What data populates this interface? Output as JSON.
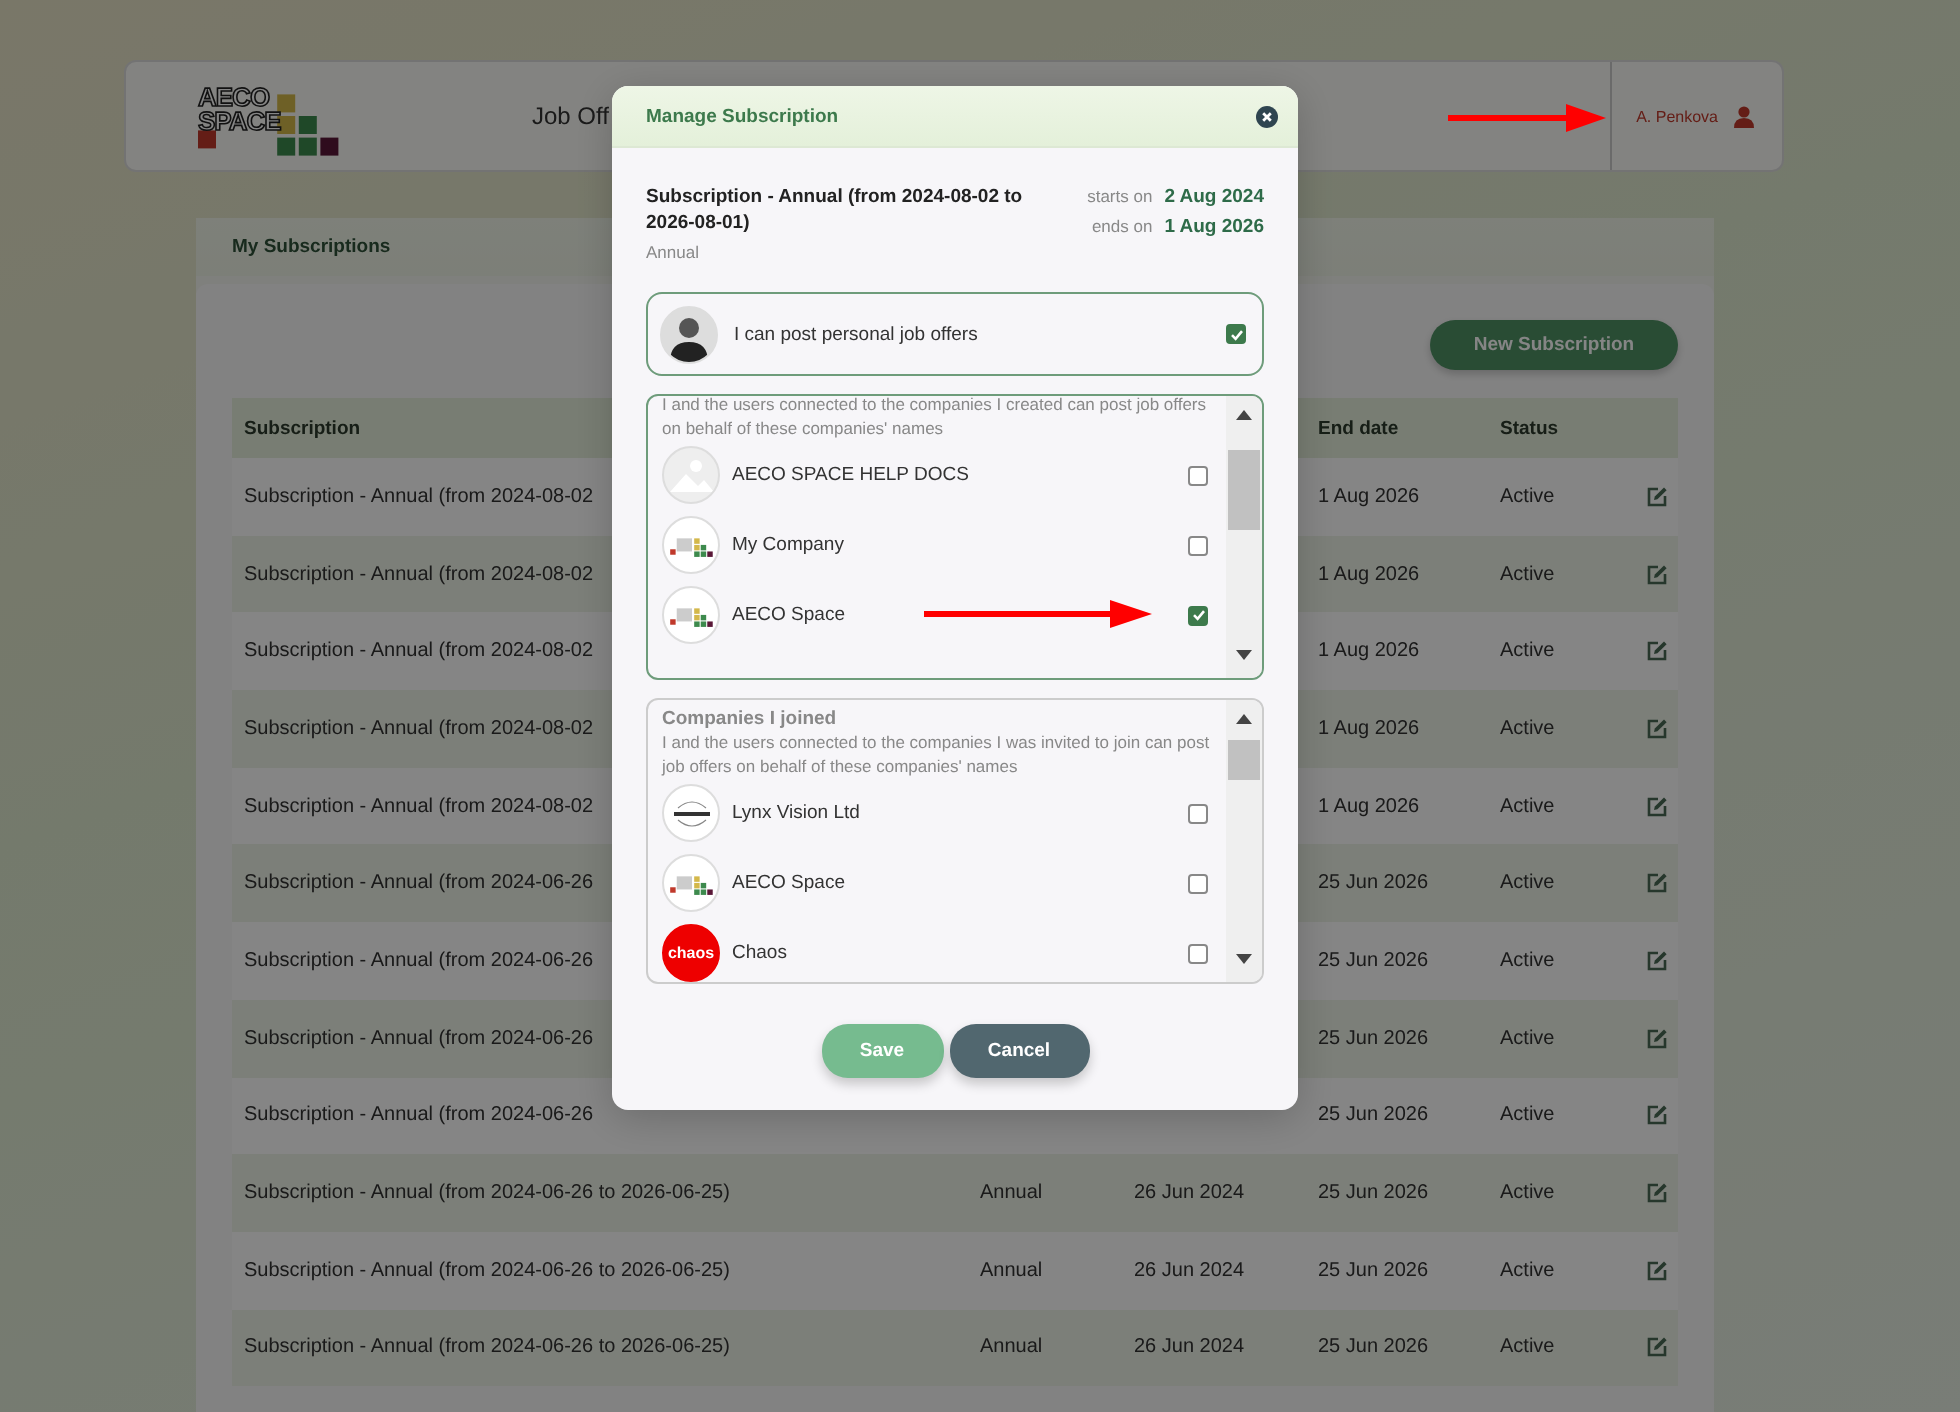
{
  "header": {
    "logo_lines": [
      "AECO",
      "SPACE"
    ],
    "nav_item": "Job Off",
    "user_name": "A. Penkova"
  },
  "panel": {
    "tab": "My Subscriptions",
    "new_button": "New Subscription",
    "table": {
      "columns": [
        "Subscription",
        "End date",
        "Status"
      ],
      "rows": [
        {
          "subscription": "Subscription - Annual (from 2024-08-02",
          "end": "1 Aug 2026",
          "status": "Active"
        },
        {
          "subscription": "Subscription - Annual (from 2024-08-02",
          "end": "1 Aug 2026",
          "status": "Active"
        },
        {
          "subscription": "Subscription - Annual (from 2024-08-02",
          "end": "1 Aug 2026",
          "status": "Active"
        },
        {
          "subscription": "Subscription - Annual (from 2024-08-02",
          "end": "1 Aug 2026",
          "status": "Active"
        },
        {
          "subscription": "Subscription - Annual (from 2024-08-02",
          "end": "1 Aug 2026",
          "status": "Active"
        },
        {
          "subscription": "Subscription - Annual (from 2024-06-26",
          "end": "25 Jun 2026",
          "status": "Active"
        },
        {
          "subscription": "Subscription - Annual (from 2024-06-26",
          "end": "25 Jun 2026",
          "status": "Active"
        },
        {
          "subscription": "Subscription - Annual (from 2024-06-26",
          "end": "25 Jun 2026",
          "status": "Active"
        },
        {
          "subscription": "Subscription - Annual (from 2024-06-26",
          "end": "25 Jun 2026",
          "status": "Active"
        },
        {
          "subscription": "Subscription - Annual (from 2024-06-26 to 2026-06-25)",
          "type": "Annual",
          "start": "26 Jun 2024",
          "end": "25 Jun 2026",
          "status": "Active"
        },
        {
          "subscription": "Subscription - Annual (from 2024-06-26 to 2026-06-25)",
          "type": "Annual",
          "start": "26 Jun 2024",
          "end": "25 Jun 2026",
          "status": "Active"
        },
        {
          "subscription": "Subscription - Annual (from 2024-06-26 to 2026-06-25)",
          "type": "Annual",
          "start": "26 Jun 2024",
          "end": "25 Jun 2026",
          "status": "Active"
        }
      ]
    }
  },
  "dialog": {
    "title": "Manage Subscription",
    "subscription_name": "Subscription - Annual (from 2024-08-02 to 2026-08-01)",
    "type": "Annual",
    "starts_label": "starts on",
    "starts": "2 Aug 2024",
    "ends_label": "ends on",
    "ends": "1 Aug 2026",
    "personal": {
      "label": "I can post personal job offers",
      "checked": true
    },
    "created": {
      "description": "I and the users connected to the companies I created can post job offers on behalf of these companies' names",
      "companies": [
        {
          "name": "AECO SPACE HELP DOCS",
          "kind": "placeholder",
          "checked": false
        },
        {
          "name": "My Company",
          "kind": "aeco",
          "checked": false
        },
        {
          "name": "AECO Space",
          "kind": "aeco",
          "checked": true
        }
      ]
    },
    "joined": {
      "title": "Companies I joined",
      "description": "I and the users connected to the companies I was invited to join can post job offers on behalf of these companies' names",
      "companies": [
        {
          "name": "Lynx Vision Ltd",
          "kind": "lynx",
          "checked": false
        },
        {
          "name": "AECO Space",
          "kind": "aeco",
          "checked": false
        },
        {
          "name": "Chaos",
          "kind": "text",
          "logo_text": "chaos",
          "checked": false
        }
      ]
    },
    "save": "Save",
    "cancel": "Cancel"
  }
}
